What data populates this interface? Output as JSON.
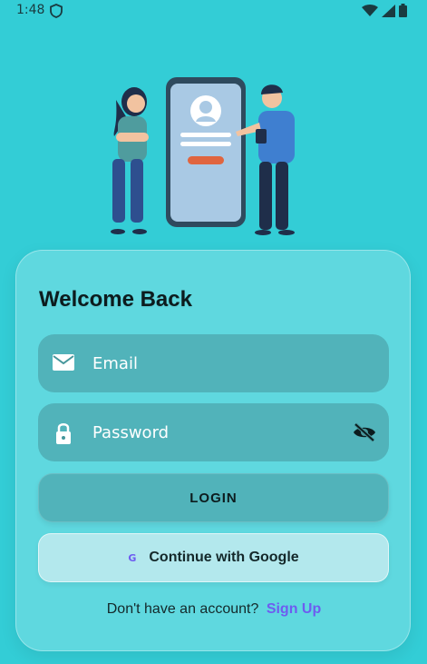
{
  "status_bar": {
    "time": "1:48",
    "icons": [
      "shield-icon",
      "wifi-icon",
      "signal-icon",
      "battery-icon"
    ]
  },
  "illustration": {
    "name": "login-illustration"
  },
  "login_card": {
    "title": "Welcome Back",
    "email_placeholder": "Email",
    "email_value": "",
    "password_placeholder": "Password",
    "password_value": "",
    "login_label": "LOGIN",
    "google_icon_glyph": "G",
    "google_label": "Continue with Google",
    "signup_prompt": "Don't have an account?",
    "signup_link": "Sign Up"
  },
  "colors": {
    "background": "#33cdd6",
    "accent": "#6e5cf0",
    "field": "#46969b"
  }
}
